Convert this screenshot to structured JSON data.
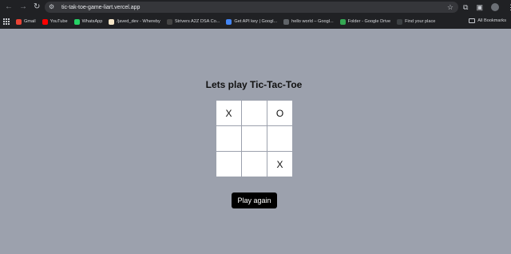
{
  "browser": {
    "url": "tic-tak-toe-game-liart.vercel.app",
    "bookmarks": [
      {
        "label": "Gmail",
        "color": "#ea4335"
      },
      {
        "label": "YouTube",
        "color": "#ff0000"
      },
      {
        "label": "WhatsApp",
        "color": "#25d366"
      },
      {
        "label": "/javed_dev - Whereby",
        "color": "#f5e6c8"
      },
      {
        "label": "Strivers A2Z DSA Co...",
        "color": "#444444"
      },
      {
        "label": "Get API key | Googl...",
        "color": "#4285f4"
      },
      {
        "label": "hello world – Googl...",
        "color": "#5f6368"
      },
      {
        "label": "Folder - Google Drive",
        "color": "#34a853"
      },
      {
        "label": "Find your place",
        "color": "#3c4043"
      }
    ],
    "all_bookmarks_label": "All Bookmarks"
  },
  "game": {
    "title": "Lets play Tic-Tac-Toe",
    "cells": [
      "X",
      "",
      "O",
      "",
      "",
      "",
      "",
      "",
      "X"
    ],
    "play_again_label": "Play again"
  }
}
